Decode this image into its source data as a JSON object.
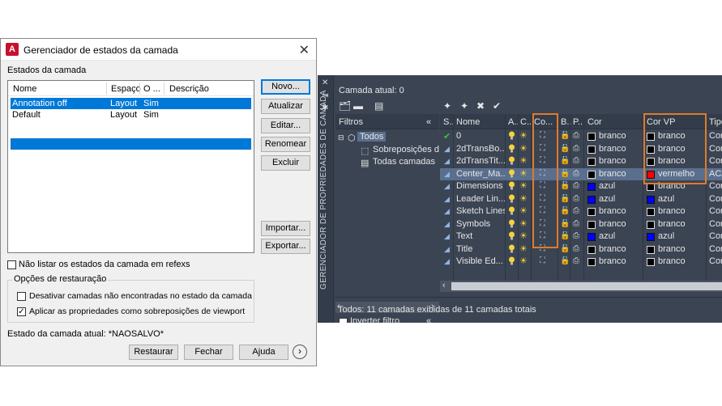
{
  "dialog": {
    "title": "Gerenciador de estados da camada",
    "close_glyph": "✕",
    "app_icon_letter": "A",
    "states_label": "Estados da camada",
    "columns": [
      "Nome",
      "Espaço",
      "O ...",
      "Descrição"
    ],
    "states": [
      {
        "name": "Annotation off",
        "space": "Layout",
        "o": "Sim",
        "desc": ""
      },
      {
        "name": "Default",
        "space": "Layout",
        "o": "Sim",
        "desc": ""
      }
    ],
    "buttons": {
      "new": "Novo...",
      "update": "Atualizar",
      "edit": "Editar...",
      "rename": "Renomear",
      "delete": "Excluir",
      "import": "Importar...",
      "export": "Exportar...",
      "restore": "Restaurar",
      "close": "Fechar",
      "help": "Ajuda"
    },
    "xref_checkbox": "Não listar os estados da camada em refexs",
    "restore_options_label": "Opções de restauração",
    "opt_disable": "Desativar camadas não encontradas no estado da camada",
    "opt_apply": "Aplicar as propriedades como sobreposições de viewport",
    "opt_apply_checked": true,
    "opt_disable_checked": false,
    "xref_checked": false,
    "current_state": "Estado da camada atual: *NAOSALVO*",
    "next_glyph": "›"
  },
  "palette": {
    "vertical_title": "GERENCIADOR DE PROPRIEDADES DE CAMADA",
    "current_layer": "Camada atual: 0",
    "filters_header": "Filtros",
    "collapse_glyph": "«",
    "tree": {
      "root": "Todos",
      "children": [
        "Sobreposições d",
        "Todas camadas"
      ]
    },
    "invert_filter": "Inverter filtro",
    "columns": [
      "S..",
      "Nome",
      "A..",
      "C..",
      "Co...",
      "B..",
      "P..",
      "Cor",
      "Cor VP",
      "Tipo"
    ],
    "layers": [
      {
        "status": "✔",
        "name": "0",
        "color": "branco",
        "color_hex": "#000000",
        "vp_color": "branco",
        "vp_hex": "#000000",
        "type": "Con"
      },
      {
        "status": "",
        "name": "2dTransBo...",
        "color": "branco",
        "color_hex": "#000000",
        "vp_color": "branco",
        "vp_hex": "#000000",
        "type": "Con"
      },
      {
        "status": "",
        "name": "2dTransTit...",
        "color": "branco",
        "color_hex": "#000000",
        "vp_color": "branco",
        "vp_hex": "#000000",
        "type": "Con"
      },
      {
        "status": "",
        "name": "Center_Ma...",
        "color": "branco",
        "color_hex": "#000000",
        "vp_color": "vermelho",
        "vp_hex": "#ff0000",
        "type": "ACA",
        "selected": true
      },
      {
        "status": "",
        "name": "Dimensions",
        "color": "azul",
        "color_hex": "#0000ff",
        "vp_color": "branco",
        "vp_hex": "#000000",
        "type": "Con"
      },
      {
        "status": "",
        "name": "Leader Lin...",
        "color": "azul",
        "color_hex": "#0000ff",
        "vp_color": "azul",
        "vp_hex": "#0000ff",
        "type": "Con"
      },
      {
        "status": "",
        "name": "Sketch Lines",
        "color": "branco",
        "color_hex": "#000000",
        "vp_color": "branco",
        "vp_hex": "#000000",
        "type": "Con"
      },
      {
        "status": "",
        "name": "Symbols",
        "color": "branco",
        "color_hex": "#000000",
        "vp_color": "branco",
        "vp_hex": "#000000",
        "type": "Con"
      },
      {
        "status": "",
        "name": "Text",
        "color": "azul",
        "color_hex": "#0000ff",
        "vp_color": "azul",
        "vp_hex": "#0000ff",
        "type": "Con"
      },
      {
        "status": "",
        "name": "Title",
        "color": "branco",
        "color_hex": "#000000",
        "vp_color": "branco",
        "vp_hex": "#000000",
        "type": "Con"
      },
      {
        "status": "",
        "name": "Visible Ed...",
        "color": "branco",
        "color_hex": "#000000",
        "vp_color": "branco",
        "vp_hex": "#000000",
        "type": "Con"
      }
    ],
    "status_text": "Todos: 11 camadas exibidas de 11 camadas totais",
    "colors": {
      "highlight": "#e07a2b",
      "selected_row": "#5a6f8d",
      "bg": "#3b4453"
    }
  }
}
